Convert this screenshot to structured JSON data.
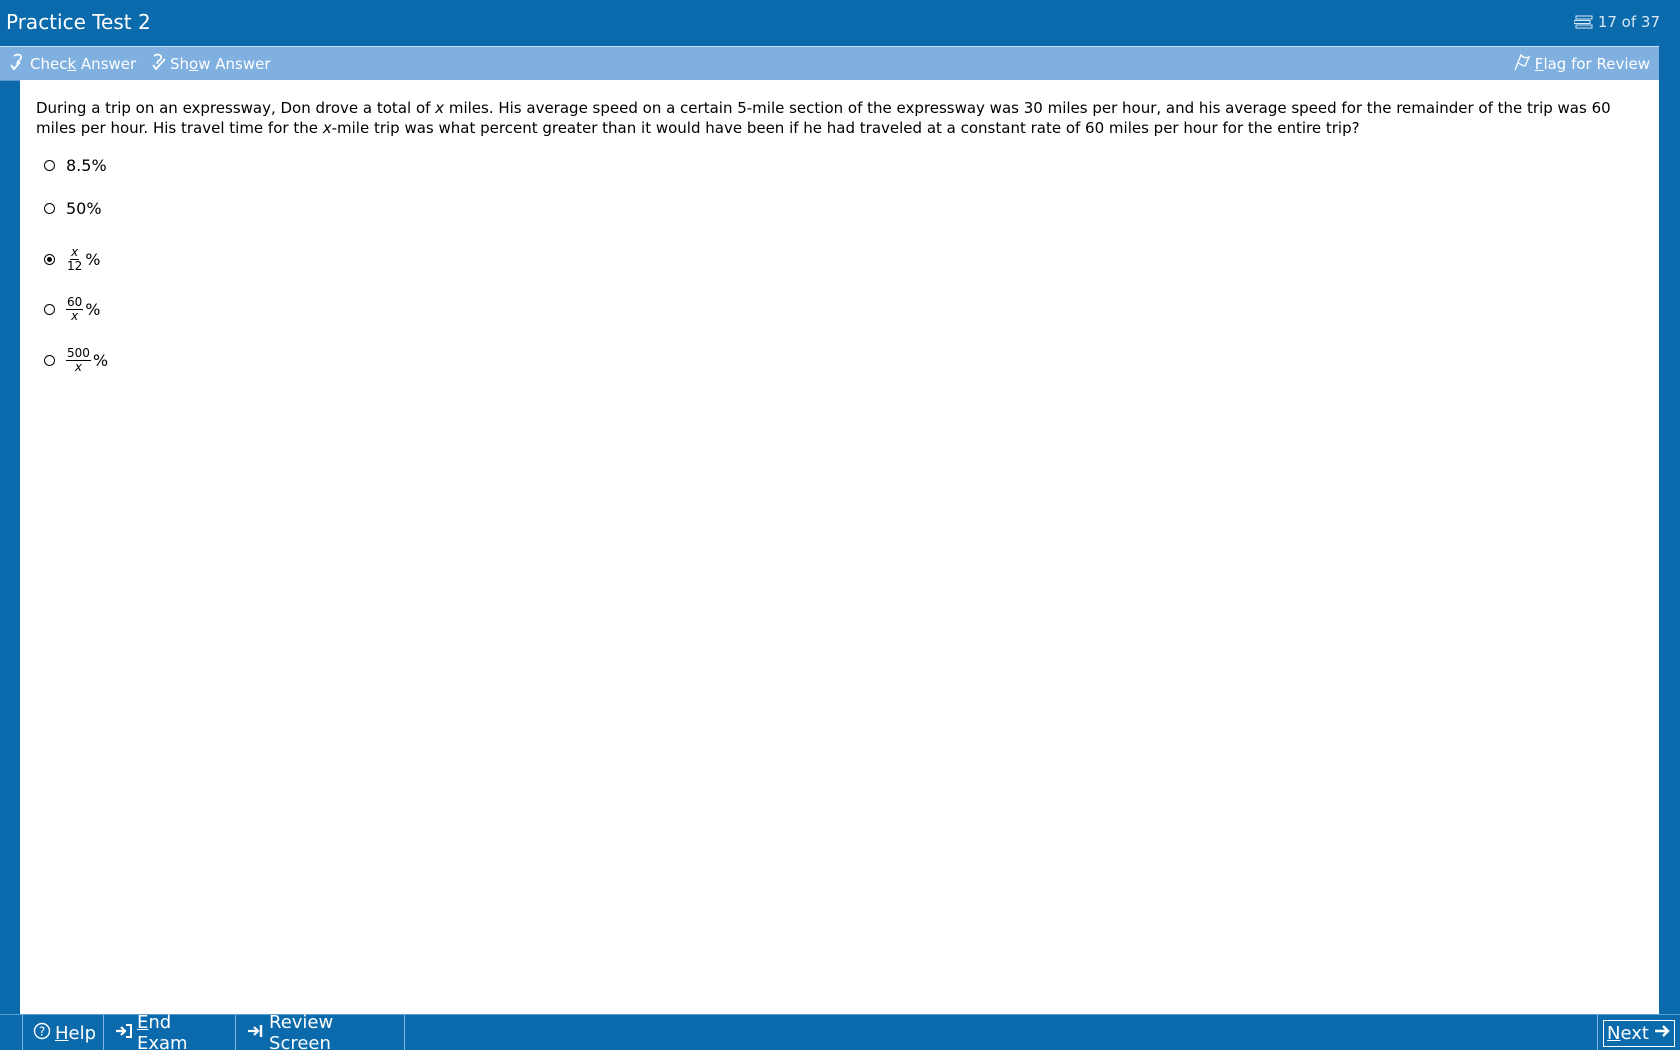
{
  "window": {
    "title": "Practice Test 2",
    "progress": "17 of 37",
    "progress_icon": "question-list-icon"
  },
  "toolbar": {
    "check_answer": {
      "before": "Chec",
      "accel": "k",
      "after": " Answer",
      "icon": "check-answer-icon"
    },
    "show_answer": {
      "before": "Sh",
      "accel": "o",
      "after": "w Answer",
      "icon": "show-answer-icon"
    },
    "flag_review": {
      "before": "",
      "accel": "F",
      "after": "lag for Review",
      "icon": "flag-icon"
    }
  },
  "question": {
    "part1": "During a trip on an expressway, Don drove a total of ",
    "var1": "x",
    "part2": " miles.  His average speed on a certain 5-mile section of the expressway was 30 miles per hour, and his average speed for the remainder of the trip was 60 miles per hour.  His travel time for the ",
    "var2": "x",
    "part3": "-mile trip was what percent greater than it would have been if he had traveled at a constant rate of 60 miles per hour for the entire trip?"
  },
  "choices": [
    {
      "text": "8.5%",
      "selected": false
    },
    {
      "text": "50%",
      "selected": false
    },
    {
      "num": "x",
      "den": "12",
      "suffix": "%",
      "selected": true
    },
    {
      "num": "60",
      "den": "x",
      "suffix": "%",
      "selected": false
    },
    {
      "num": "500",
      "den": "x",
      "suffix": "%",
      "selected": false
    }
  ],
  "bottombar": {
    "help": {
      "before": "",
      "accel": "H",
      "after": "elp",
      "icon": "help-icon"
    },
    "end_exam": {
      "before": "",
      "accel": "E",
      "after": "nd Exam",
      "icon": "end-exam-icon"
    },
    "review": {
      "before": "Review ",
      "accel": "S",
      "after": "creen",
      "icon": "review-screen-icon"
    },
    "next": {
      "before": "",
      "accel": "N",
      "after": "ext",
      "icon": "next-arrow-icon"
    }
  },
  "colors": {
    "frame_blue": "#0a6aab",
    "toolbar_blue": "#7fb0e0",
    "content_bg": "#ffffff"
  }
}
